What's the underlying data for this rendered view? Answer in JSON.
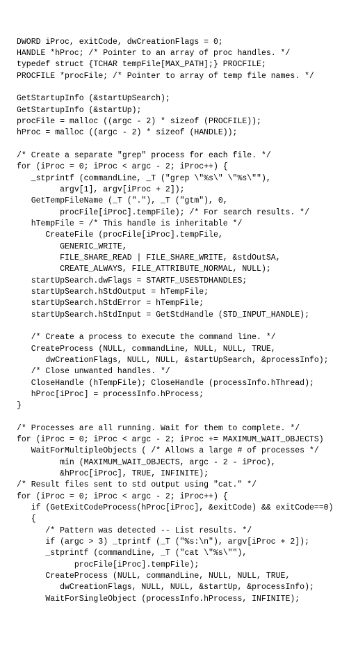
{
  "code": {
    "lines": [
      "DWORD iProc, exitCode, dwCreationFlags = 0;",
      "HANDLE *hProc; /* Pointer to an array of proc handles. */",
      "typedef struct {TCHAR tempFile[MAX_PATH];} PROCFILE;",
      "PROCFILE *procFile; /* Pointer to array of temp file names. */",
      "",
      "GetStartupInfo (&startUpSearch);",
      "GetStartupInfo (&startUp);",
      "procFile = malloc ((argc - 2) * sizeof (PROCFILE));",
      "hProc = malloc ((argc - 2) * sizeof (HANDLE));",
      "",
      "/* Create a separate \"grep\" process for each file. */",
      "for (iProc = 0; iProc < argc - 2; iProc++) {",
      "   _stprintf (commandLine, _T (\"grep \\\"%s\\\" \\\"%s\\\"\"),",
      "         argv[1], argv[iProc + 2]);",
      "   GetTempFileName (_T (\".\"), _T (\"gtm\"), 0,",
      "         procFile[iProc].tempFile); /* For search results. */",
      "   hTempFile = /* This handle is inheritable */",
      "      CreateFile (procFile[iProc].tempFile,",
      "         GENERIC_WRITE,",
      "         FILE_SHARE_READ | FILE_SHARE_WRITE, &stdOutSA,",
      "         CREATE_ALWAYS, FILE_ATTRIBUTE_NORMAL, NULL);",
      "   startUpSearch.dwFlags = STARTF_USESTDHANDLES;",
      "   startUpSearch.hStdOutput = hTempFile;",
      "   startUpSearch.hStdError = hTempFile;",
      "   startUpSearch.hStdInput = GetStdHandle (STD_INPUT_HANDLE);",
      "",
      "   /* Create a process to execute the command line. */",
      "   CreateProcess (NULL, commandLine, NULL, NULL, TRUE,",
      "      dwCreationFlags, NULL, NULL, &startUpSearch, &processInfo);",
      "   /* Close unwanted handles. */",
      "   CloseHandle (hTempFile); CloseHandle (processInfo.hThread);",
      "   hProc[iProc] = processInfo.hProcess;",
      "}",
      "",
      "/* Processes are all running. Wait for them to complete. */",
      "for (iProc = 0; iProc < argc - 2; iProc += MAXIMUM_WAIT_OBJECTS)",
      "   WaitForMultipleObjects ( /* Allows a large # of processes */",
      "         min (MAXIMUM_WAIT_OBJECTS, argc - 2 - iProc),",
      "         &hProc[iProc], TRUE, INFINITE);",
      "/* Result files sent to std output using \"cat.\" */",
      "for (iProc = 0; iProc < argc - 2; iProc++) {",
      "   if (GetExitCodeProcess(hProc[iProc], &exitCode) && exitCode==0)",
      "   {",
      "      /* Pattern was detected -- List results. */",
      "      if (argc > 3) _tprintf (_T (\"%s:\\n\"), argv[iProc + 2]);",
      "      _stprintf (commandLine, _T (\"cat \\\"%s\\\"\"),",
      "            procFile[iProc].tempFile);",
      "      CreateProcess (NULL, commandLine, NULL, NULL, TRUE,",
      "         dwCreationFlags, NULL, NULL, &startUp, &processInfo);",
      "      WaitForSingleObject (processInfo.hProcess, INFINITE);"
    ]
  }
}
